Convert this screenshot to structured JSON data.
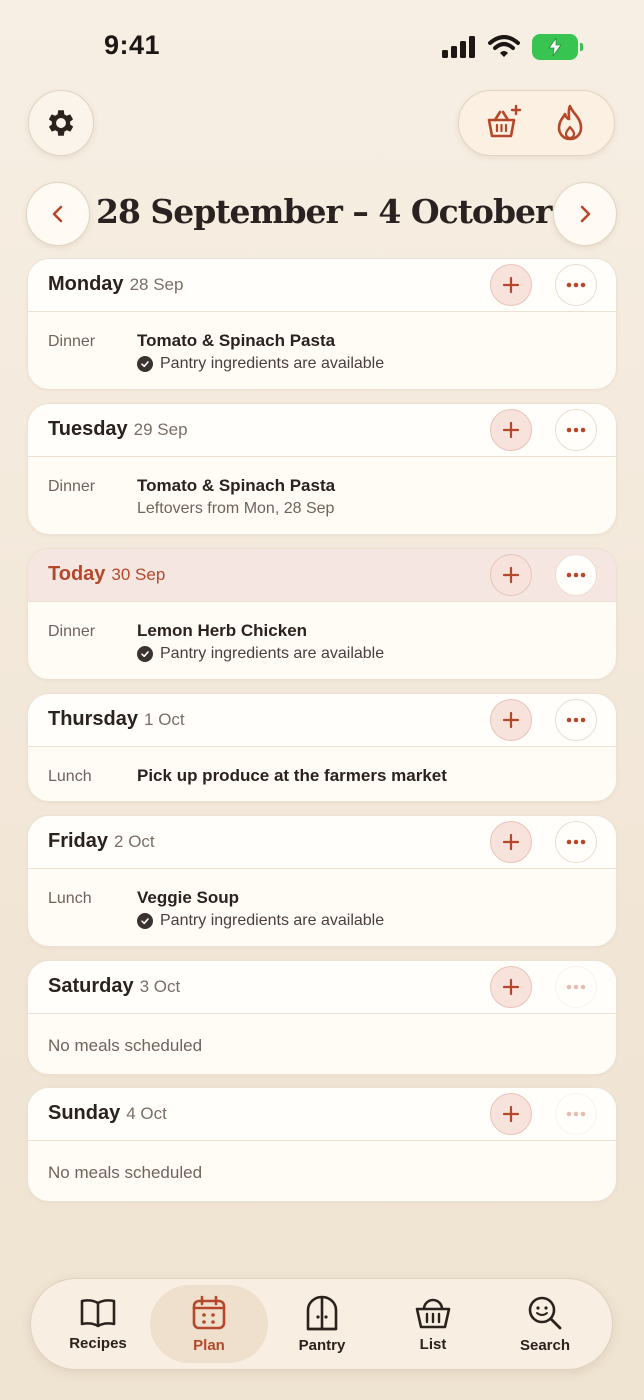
{
  "status_bar": {
    "time": "9:41"
  },
  "week": {
    "title": "28 September – 4 October"
  },
  "days": [
    {
      "name": "Monday",
      "date": "28 Sep",
      "meal": {
        "type": "Dinner",
        "title": "Tomato & Spinach Pasta",
        "sub": "Pantry ingredients are available",
        "sub_kind": "check"
      }
    },
    {
      "name": "Tuesday",
      "date": "29 Sep",
      "meal": {
        "type": "Dinner",
        "title": "Tomato & Spinach Pasta",
        "sub": "Leftovers from Mon, 28 Sep",
        "sub_kind": "plain"
      }
    },
    {
      "name": "Today",
      "date": "30 Sep",
      "meal": {
        "type": "Dinner",
        "title": "Lemon Herb Chicken",
        "sub": "Pantry ingredients are available",
        "sub_kind": "check"
      }
    },
    {
      "name": "Thursday",
      "date": "1 Oct",
      "meal": {
        "type": "Lunch",
        "title": "Pick up produce at the farmers market"
      }
    },
    {
      "name": "Friday",
      "date": "2 Oct",
      "meal": {
        "type": "Lunch",
        "title": "Veggie Soup",
        "sub": "Pantry ingredients are available",
        "sub_kind": "check"
      }
    },
    {
      "name": "Saturday",
      "date": "3 Oct",
      "empty": "No meals scheduled"
    },
    {
      "name": "Sunday",
      "date": "4 Oct",
      "empty": "No meals scheduled"
    }
  ],
  "tabs": [
    {
      "label": "Recipes",
      "icon": "book-icon"
    },
    {
      "label": "Plan",
      "icon": "calendar-icon",
      "active": true
    },
    {
      "label": "Pantry",
      "icon": "pantry-icon"
    },
    {
      "label": "List",
      "icon": "basket-icon"
    },
    {
      "label": "Search",
      "icon": "search-icon"
    }
  ],
  "colors": {
    "accent": "#b5482a",
    "today_bg": "#f5e6e2",
    "add_bg": "#f7e2dc",
    "battery": "#38c450"
  }
}
